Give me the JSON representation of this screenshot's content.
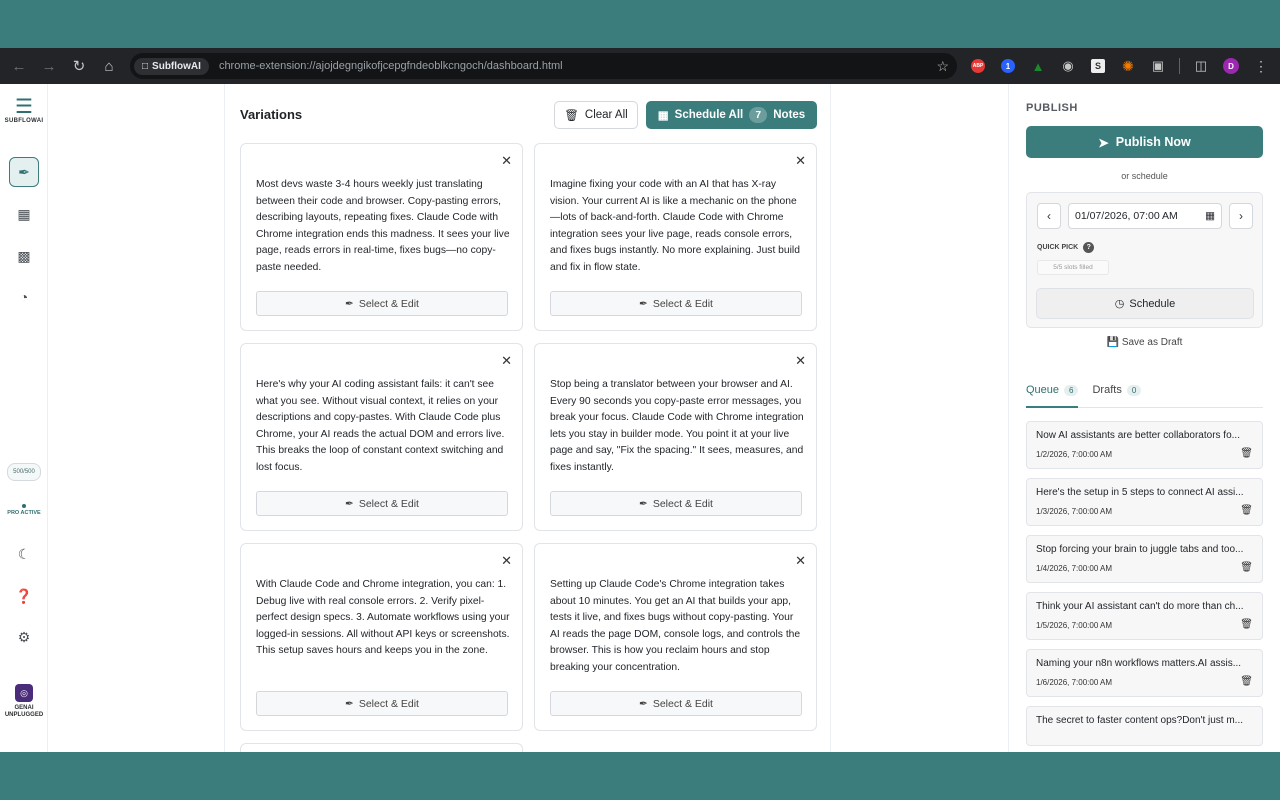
{
  "browser": {
    "site_chip": "SubflowAI",
    "url": "chrome-extension://ajojdegngikofjcepgfndeoblkcngoch/dashboard.html",
    "avatar_letter": "D"
  },
  "rail": {
    "logo_text": "SUBFLOWAI",
    "credits": "500/500",
    "pro_status": "PRO ACTIVE",
    "brand_line1": "GENAI",
    "brand_line2": "UNPLUGGED"
  },
  "main": {
    "title": "Variations",
    "clear_all": "Clear All",
    "schedule_all": "Schedule All",
    "schedule_count": "7",
    "schedule_suffix": "Notes",
    "select_edit": "Select & Edit",
    "cards": [
      "Most devs waste 3-4 hours weekly just translating between their code and browser. Copy-pasting errors, describing layouts, repeating fixes. Claude Code with Chrome integration ends this madness. It sees your live page, reads errors in real-time, fixes bugs—no copy-paste needed.",
      "Imagine fixing your code with an AI that has X-ray vision. Your current AI is like a mechanic on the phone—lots of back-and-forth. Claude Code with Chrome integration sees your live page, reads console errors, and fixes bugs instantly. No more explaining. Just build and fix in flow state.",
      "Here's why your AI coding assistant fails: it can't see what you see. Without visual context, it relies on your descriptions and copy-pastes. With Claude Code plus Chrome, your AI reads the actual DOM and errors live. This breaks the loop of constant context switching and lost focus.",
      "Stop being a translator between your browser and AI. Every 90 seconds you copy-paste error messages, you break your focus. Claude Code with Chrome integration lets you stay in builder mode. You point it at your live page and say, \"Fix the spacing.\" It sees, measures, and fixes instantly.",
      "With Claude Code and Chrome integration, you can: 1. Debug live with real console errors. 2. Verify pixel-perfect design specs. 3. Automate workflows using your logged-in sessions. All without API keys or screenshots. This setup saves hours and keeps you in the zone.",
      "Setting up Claude Code's Chrome integration takes about 10 minutes. You get an AI that builds your app, tests it live, and fixes bugs without copy-pasting. Your AI reads the page DOM, console logs, and controls the browser. This is how you reclaim hours and stop breaking your concentration."
    ]
  },
  "right": {
    "publish_label": "PUBLISH",
    "publish_now": "Publish Now",
    "or_schedule": "or schedule",
    "datetime": "01/07/2026, 07:00 AM",
    "quick_pick": "QUICK PICK",
    "slots": "5/5 slots filled",
    "schedule": "Schedule",
    "save_draft": "Save as Draft",
    "tabs": [
      {
        "label": "Queue",
        "count": "6"
      },
      {
        "label": "Drafts",
        "count": "0"
      }
    ],
    "queue": [
      {
        "title": "Now AI assistants are better collaborators fo...",
        "date": "1/2/2026, 7:00:00 AM"
      },
      {
        "title": "Here's the setup in 5 steps to connect AI assi...",
        "date": "1/3/2026, 7:00:00 AM"
      },
      {
        "title": "Stop forcing your brain to juggle tabs and too...",
        "date": "1/4/2026, 7:00:00 AM"
      },
      {
        "title": "Think your AI assistant can't do more than ch...",
        "date": "1/5/2026, 7:00:00 AM"
      },
      {
        "title": "Naming your n8n workflows matters.AI assis...",
        "date": "1/6/2026, 7:00:00 AM"
      },
      {
        "title": "The secret to faster content ops?Don't just m...",
        "date": ""
      }
    ]
  }
}
